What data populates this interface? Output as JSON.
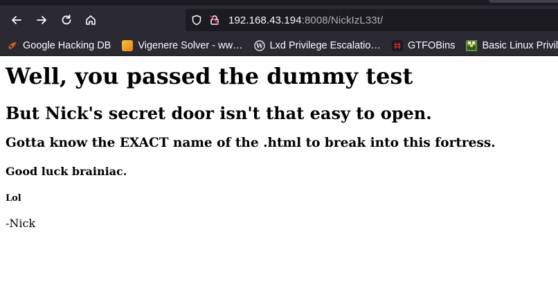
{
  "browser": {
    "url_host": "192.168.43.194",
    "url_rest": ":8008/NickIzL33t/",
    "bookmarks": [
      {
        "label": "Google Hacking DB",
        "icon": "exploit-db-icon",
        "color": "#e05a1a"
      },
      {
        "label": "Vigenere Solver - ww…",
        "icon": "dcode-icon",
        "color": "#f0a020"
      },
      {
        "label": "Lxd Privilege Escalatio…",
        "icon": "wordpress-icon",
        "color": "#d0d0d0"
      },
      {
        "label": "GTFOBins",
        "icon": "gtfobins-icon",
        "color": "#c02020"
      },
      {
        "label": "Basic Linux Privilege",
        "icon": "pixel-game-icon",
        "color": "#3a8a3a"
      }
    ]
  },
  "page": {
    "h1": "Well, you passed the dummy test",
    "h2": "But Nick's secret door isn't that easy to open.",
    "h3": "Gotta know the EXACT name of the .html to break into this fortress.",
    "h4": "Good luck brainiac.",
    "h5": "Lol",
    "signature": "-Nick"
  }
}
